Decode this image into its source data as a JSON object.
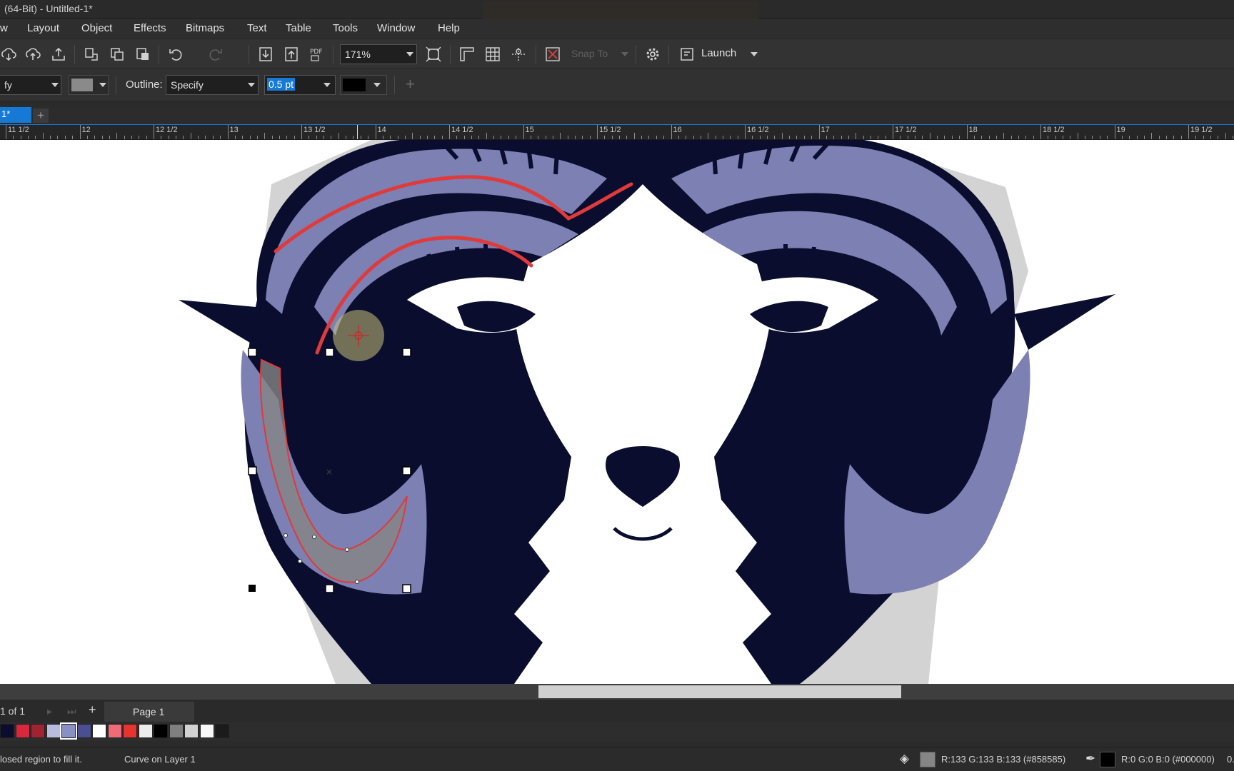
{
  "title": "(64-Bit) - Untitled-1*",
  "menu": [
    "w",
    "Layout",
    "Object",
    "Effects",
    "Bitmaps",
    "Text",
    "Table",
    "Tools",
    "Window",
    "Help"
  ],
  "toolbar": {
    "zoom": "171%",
    "snap_label": "Snap To",
    "launch_label": "Launch",
    "pdf_label": "PDF"
  },
  "propbar": {
    "fill_combo": "fy",
    "outline_label": "Outline:",
    "outline_type": "Specify",
    "outline_width": "0.5 pt"
  },
  "doc_tab": "1*",
  "add_tab_symbol": "+",
  "ruler": {
    "labels": [
      "11 1/2",
      "12",
      "12 1/2",
      "13",
      "13 1/2",
      "14",
      "14 1/2",
      "15",
      "15 1/2",
      "16",
      "16 1/2",
      "17",
      "17 1/2",
      "18",
      "18 1/2",
      "19",
      "19 1/2"
    ]
  },
  "page_nav": {
    "count": "1  of  1",
    "add": "+",
    "page_label": "Page 1"
  },
  "palette": [
    "#0a0d2e",
    "#d8283c",
    "#a12230",
    "#b9bcdf",
    "#8a8fc4",
    "#4b4f92",
    "#ffffff",
    "#f06b78",
    "#e8332e",
    "#ececec",
    "#000000",
    "#7f7f7f",
    "#d2d2d2",
    "#f7f7f7",
    "#1b1b1b"
  ],
  "status": {
    "hint": "losed region to fill it.",
    "object": "Curve on Layer 1",
    "fill_info": "R:133 G:133 B:133 (#858585)",
    "outline_info": "R:0 G:0 B:0 (#000000)",
    "tail": "0."
  },
  "colors": {
    "accent": "#1679d6",
    "ram_navy": "#0a0d2e",
    "horn_lavender": "#7c80b2",
    "guide_red": "#e03a3a",
    "fill_gray": "#858585"
  }
}
